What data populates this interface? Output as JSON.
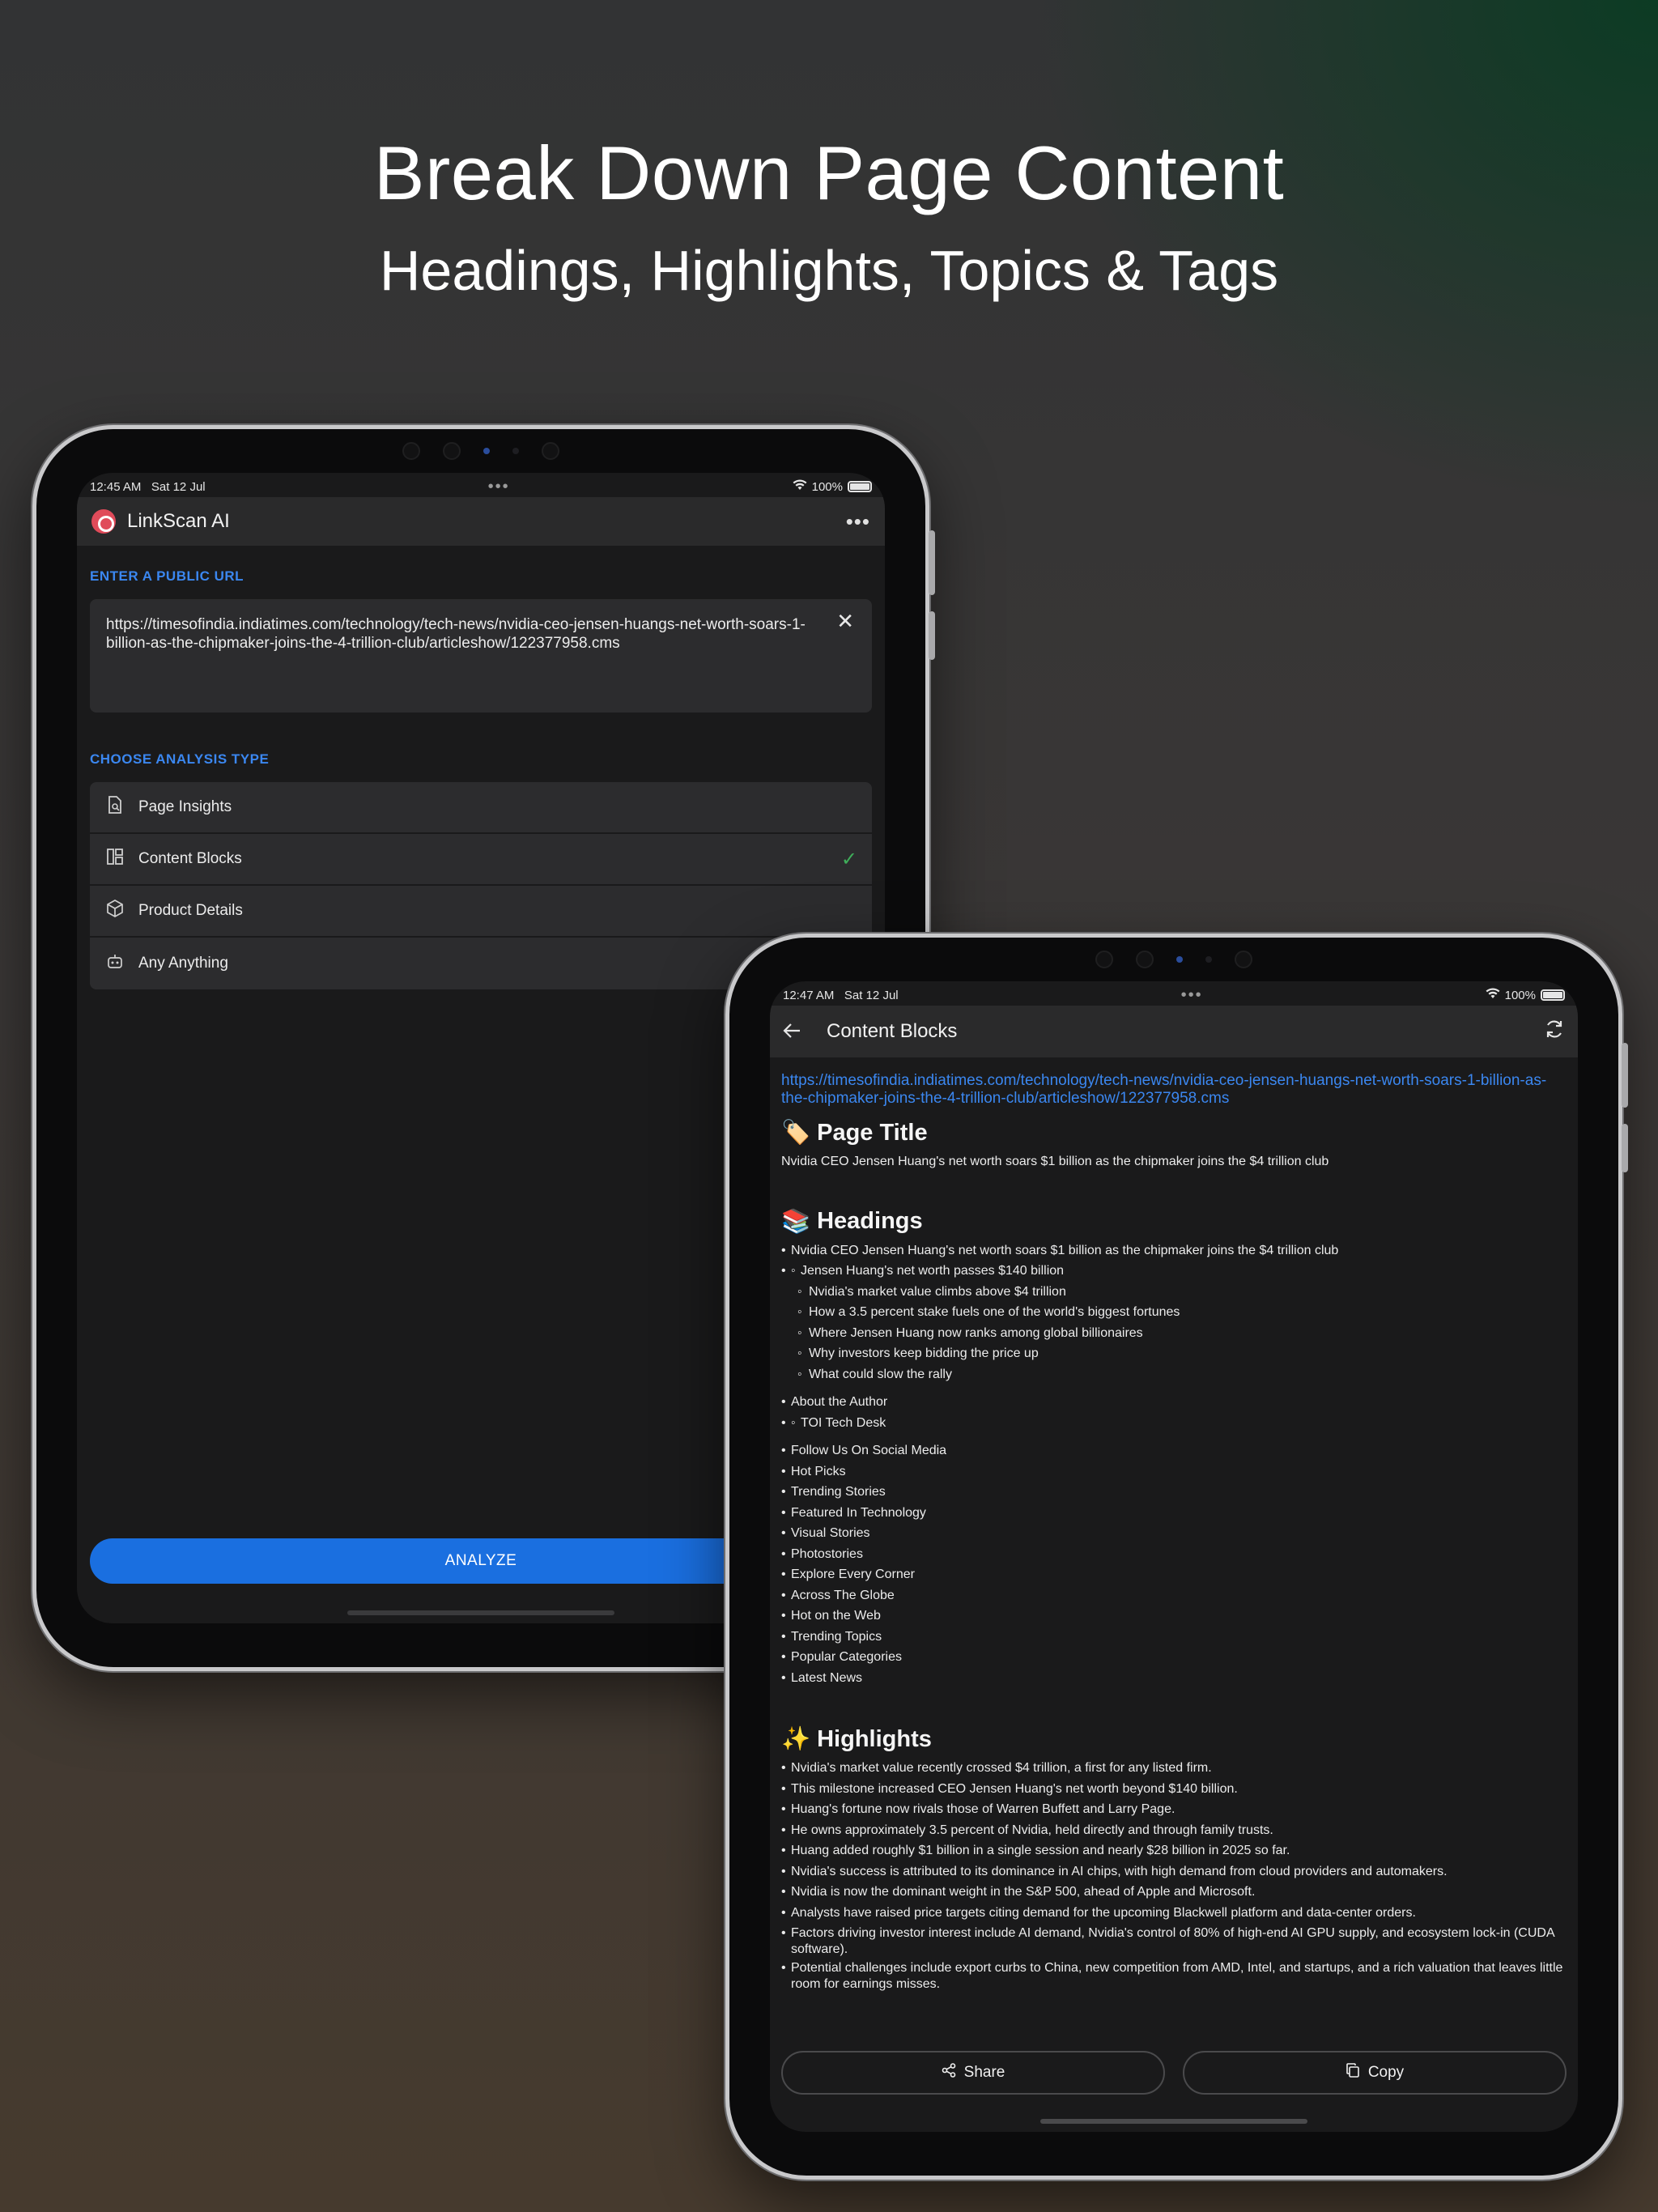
{
  "promo": {
    "title": "Break Down Page Content",
    "subtitle": "Headings, Highlights, Topics & Tags"
  },
  "left_device": {
    "status": {
      "time": "12:45 AM",
      "date": "Sat 12 Jul",
      "battery": "100%"
    },
    "app_title": "LinkScan AI",
    "url_label": "ENTER A PUBLIC URL",
    "url_value": "https://timesofindia.indiatimes.com/technology/tech-news/nvidia-ceo-jensen-huangs-net-worth-soars-1-billion-as-the-chipmaker-joins-the-4-trillion-club/articleshow/122377958.cms",
    "analysis_label": "CHOOSE ANALYSIS TYPE",
    "options": [
      {
        "label": "Page Insights",
        "icon": "page-search-icon",
        "selected": false
      },
      {
        "label": "Content Blocks",
        "icon": "layout-blocks-icon",
        "selected": true
      },
      {
        "label": "Product Details",
        "icon": "box-icon",
        "selected": false
      },
      {
        "label": "Any Anything",
        "icon": "robot-icon",
        "selected": false
      }
    ],
    "analyze_label": "ANALYZE"
  },
  "right_device": {
    "status": {
      "time": "12:47 AM",
      "date": "Sat 12 Jul",
      "battery": "100%"
    },
    "nav_title": "Content Blocks",
    "url": "https://timesofindia.indiatimes.com/technology/tech-news/nvidia-ceo-jensen-huangs-net-worth-soars-1-billion-as-the-chipmaker-joins-the-4-trillion-club/articleshow/122377958.cms",
    "page_title_heading": "Page Title",
    "page_title_icon": "🏷️",
    "page_title_text": "Nvidia CEO Jensen Huang's net worth soars $1 billion as the chipmaker joins the $4 trillion club",
    "headings_heading": "Headings",
    "headings_icon": "📚",
    "headings": {
      "h1": "Nvidia CEO Jensen Huang's net worth soars $1 billion as the chipmaker joins the $4 trillion club",
      "sub1": [
        "Jensen Huang's net worth passes $140 billion",
        "Nvidia's market value climbs above $4 trillion",
        "How a 3.5 percent stake fuels one of the world's biggest fortunes",
        "Where Jensen Huang now ranks among global billionaires",
        "Why investors keep bidding the price up",
        "What could slow the rally"
      ],
      "about": "About the Author",
      "sub2": [
        "TOI Tech Desk"
      ],
      "more": [
        "Follow Us On Social Media",
        "Hot Picks",
        "Trending Stories",
        "Featured In Technology",
        "Visual Stories",
        "Photostories",
        "Explore Every Corner",
        "Across The Globe",
        "Hot on the Web",
        "Trending Topics",
        "Popular Categories",
        "Latest News"
      ]
    },
    "highlights_heading": "Highlights",
    "highlights_icon": "✨",
    "highlights": [
      "Nvidia's market value recently crossed $4 trillion, a first for any listed firm.",
      "This milestone increased CEO Jensen Huang's net worth beyond $140 billion.",
      "Huang's fortune now rivals those of Warren Buffett and Larry Page.",
      "He owns approximately 3.5 percent of Nvidia, held directly and through family trusts.",
      "Huang added roughly $1 billion in a single session and nearly $28 billion in 2025 so far.",
      "Nvidia's success is attributed to its dominance in AI chips, with high demand from cloud providers and automakers.",
      "Nvidia is now the dominant weight in the S&P 500, ahead of Apple and Microsoft.",
      "Analysts have raised price targets citing demand for the upcoming Blackwell platform and data-center orders.",
      "Factors driving investor interest include AI demand, Nvidia's control of 80% of high-end AI GPU supply, and ecosystem lock-in (CUDA software).",
      "Potential challenges include export curbs to China, new competition from AMD, Intel, and startups, and a rich valuation that leaves little room for earnings misses."
    ],
    "share_label": "Share",
    "copy_label": "Copy"
  }
}
